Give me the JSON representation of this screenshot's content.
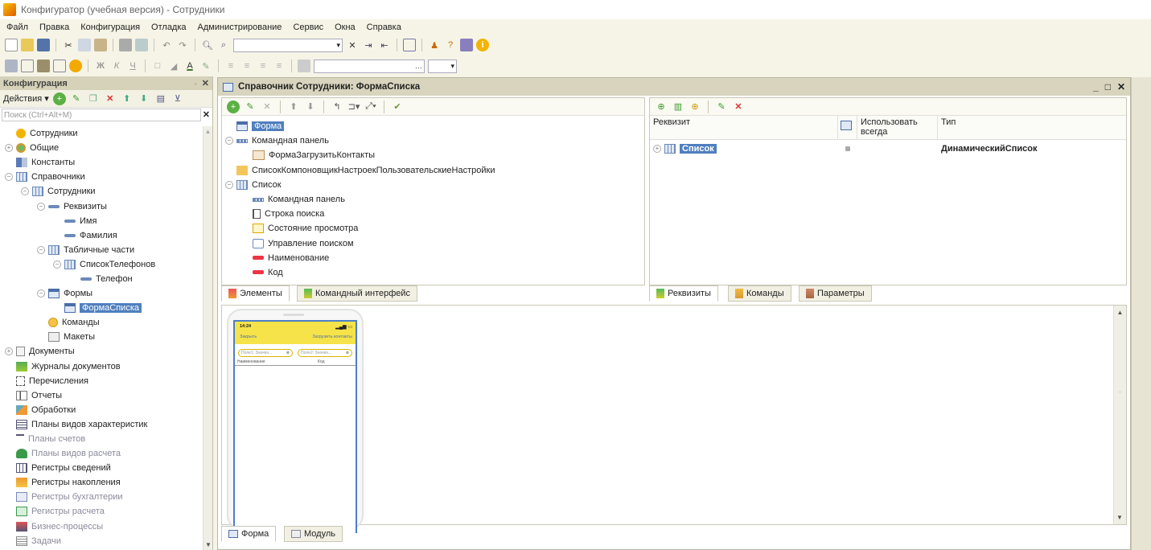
{
  "window": {
    "title": "Конфигуратор (учебная версия) - Сотрудники"
  },
  "menu": [
    "Файл",
    "Правка",
    "Конфигурация",
    "Отладка",
    "Администрирование",
    "Сервис",
    "Окна",
    "Справка"
  ],
  "toolbar2": {
    "bold": "Ж",
    "italic": "К",
    "underline": "Ч"
  },
  "left_panel": {
    "title": "Конфигурация",
    "actions_label": "Действия",
    "search_placeholder": "Поиск (Ctrl+Alt+M)",
    "tree": [
      {
        "label": "Сотрудники",
        "icon": "config-icon",
        "level": 0,
        "expander": ""
      },
      {
        "label": "Общие",
        "icon": "common-icon",
        "level": 0,
        "expander": "+"
      },
      {
        "label": "Константы",
        "icon": "constants-icon",
        "level": 0,
        "expander": ""
      },
      {
        "label": "Справочники",
        "icon": "catalog-icon",
        "level": 0,
        "expander": "−"
      },
      {
        "label": "Сотрудники",
        "icon": "catalog-icon",
        "level": 1,
        "expander": "−"
      },
      {
        "label": "Реквизиты",
        "icon": "attribute-icon",
        "level": 2,
        "expander": "−"
      },
      {
        "label": "Имя",
        "icon": "attribute-icon",
        "level": 3,
        "expander": ""
      },
      {
        "label": "Фамилия",
        "icon": "attribute-icon",
        "level": 3,
        "expander": ""
      },
      {
        "label": "Табличные части",
        "icon": "table-icon",
        "level": 2,
        "expander": "−"
      },
      {
        "label": "СписокТелефонов",
        "icon": "table-icon",
        "level": 3,
        "expander": "−"
      },
      {
        "label": "Телефон",
        "icon": "attribute-icon",
        "level": 4,
        "expander": ""
      },
      {
        "label": "Формы",
        "icon": "form-icon",
        "level": 2,
        "expander": "−"
      },
      {
        "label": "ФормаСписка",
        "icon": "form-icon",
        "level": 3,
        "expander": "",
        "selected": true
      },
      {
        "label": "Команды",
        "icon": "command-icon",
        "level": 2,
        "expander": ""
      },
      {
        "label": "Макеты",
        "icon": "template-icon",
        "level": 2,
        "expander": ""
      },
      {
        "label": "Документы",
        "icon": "document-icon",
        "level": 0,
        "expander": "+"
      },
      {
        "label": "Журналы документов",
        "icon": "journal-icon",
        "level": 0,
        "expander": ""
      },
      {
        "label": "Перечисления",
        "icon": "enum-icon",
        "level": 0,
        "expander": ""
      },
      {
        "label": "Отчеты",
        "icon": "report-icon",
        "level": 0,
        "expander": ""
      },
      {
        "label": "Обработки",
        "icon": "processing-icon",
        "level": 0,
        "expander": ""
      },
      {
        "label": "Планы видов характеристик",
        "icon": "chart-types-icon",
        "level": 0,
        "expander": ""
      },
      {
        "label": "Планы счетов",
        "icon": "accounts-icon",
        "level": 0,
        "expander": "",
        "gray": true
      },
      {
        "label": "Планы видов расчета",
        "icon": "calc-types-icon",
        "level": 0,
        "expander": "",
        "gray": true
      },
      {
        "label": "Регистры сведений",
        "icon": "info-register-icon",
        "level": 0,
        "expander": ""
      },
      {
        "label": "Регистры накопления",
        "icon": "accum-register-icon",
        "level": 0,
        "expander": ""
      },
      {
        "label": "Регистры бухгалтерии",
        "icon": "acc-register-icon",
        "level": 0,
        "expander": "",
        "gray": true
      },
      {
        "label": "Регистры расчета",
        "icon": "calc-register-icon",
        "level": 0,
        "expander": "",
        "gray": true
      },
      {
        "label": "Бизнес-процессы",
        "icon": "business-process-icon",
        "level": 0,
        "expander": "",
        "gray": true
      },
      {
        "label": "Задачи",
        "icon": "task-icon",
        "level": 0,
        "expander": "",
        "gray": true
      }
    ]
  },
  "editor": {
    "title": "Справочник Сотрудники: ФормаСписка",
    "elements_tree": [
      {
        "label": "Форма",
        "icon": "form-icon",
        "level": 0,
        "expander": "",
        "selected": true
      },
      {
        "label": "Командная панель",
        "icon": "command-panel-icon",
        "level": 0,
        "expander": "−"
      },
      {
        "label": "ФормаЗагрузитьКонтакты",
        "icon": "button-icon",
        "level": 1,
        "expander": ""
      },
      {
        "label": "СписокКомпоновщикНастроекПользовательскиеНастройки",
        "icon": "folder-icon",
        "level": 0,
        "expander": ""
      },
      {
        "label": "Список",
        "icon": "table-icon",
        "level": 0,
        "expander": "−"
      },
      {
        "label": "Командная панель",
        "icon": "command-panel-icon",
        "level": 1,
        "expander": ""
      },
      {
        "label": "Строка поиска",
        "icon": "search-string-icon",
        "level": 1,
        "expander": ""
      },
      {
        "label": "Состояние просмотра",
        "icon": "view-status-icon",
        "level": 1,
        "expander": ""
      },
      {
        "label": "Управление поиском",
        "icon": "search-control-icon",
        "level": 1,
        "expander": ""
      },
      {
        "label": "Наименование",
        "icon": "field-icon",
        "level": 1,
        "expander": ""
      },
      {
        "label": "Код",
        "icon": "field-icon",
        "level": 1,
        "expander": ""
      }
    ],
    "left_tabs": [
      "Элементы",
      "Командный интерфейс"
    ],
    "right_header": {
      "col1": "Реквизит",
      "col2": "Использовать всегда",
      "col3": "Тип"
    },
    "right_rows": [
      {
        "name": "Список",
        "type": "ДинамическийСписок"
      }
    ],
    "right_tabs": [
      "Реквизиты",
      "Команды",
      "Параметры"
    ],
    "bottom_tabs": [
      "Форма",
      "Модуль"
    ],
    "phone": {
      "time": "14:24",
      "close": "Закрыть",
      "load": "Загрузить контакты",
      "field1": "Поле1: Значен...",
      "field2": "Поле2: Значен...",
      "col1": "Наименование",
      "col2": "Код"
    }
  }
}
